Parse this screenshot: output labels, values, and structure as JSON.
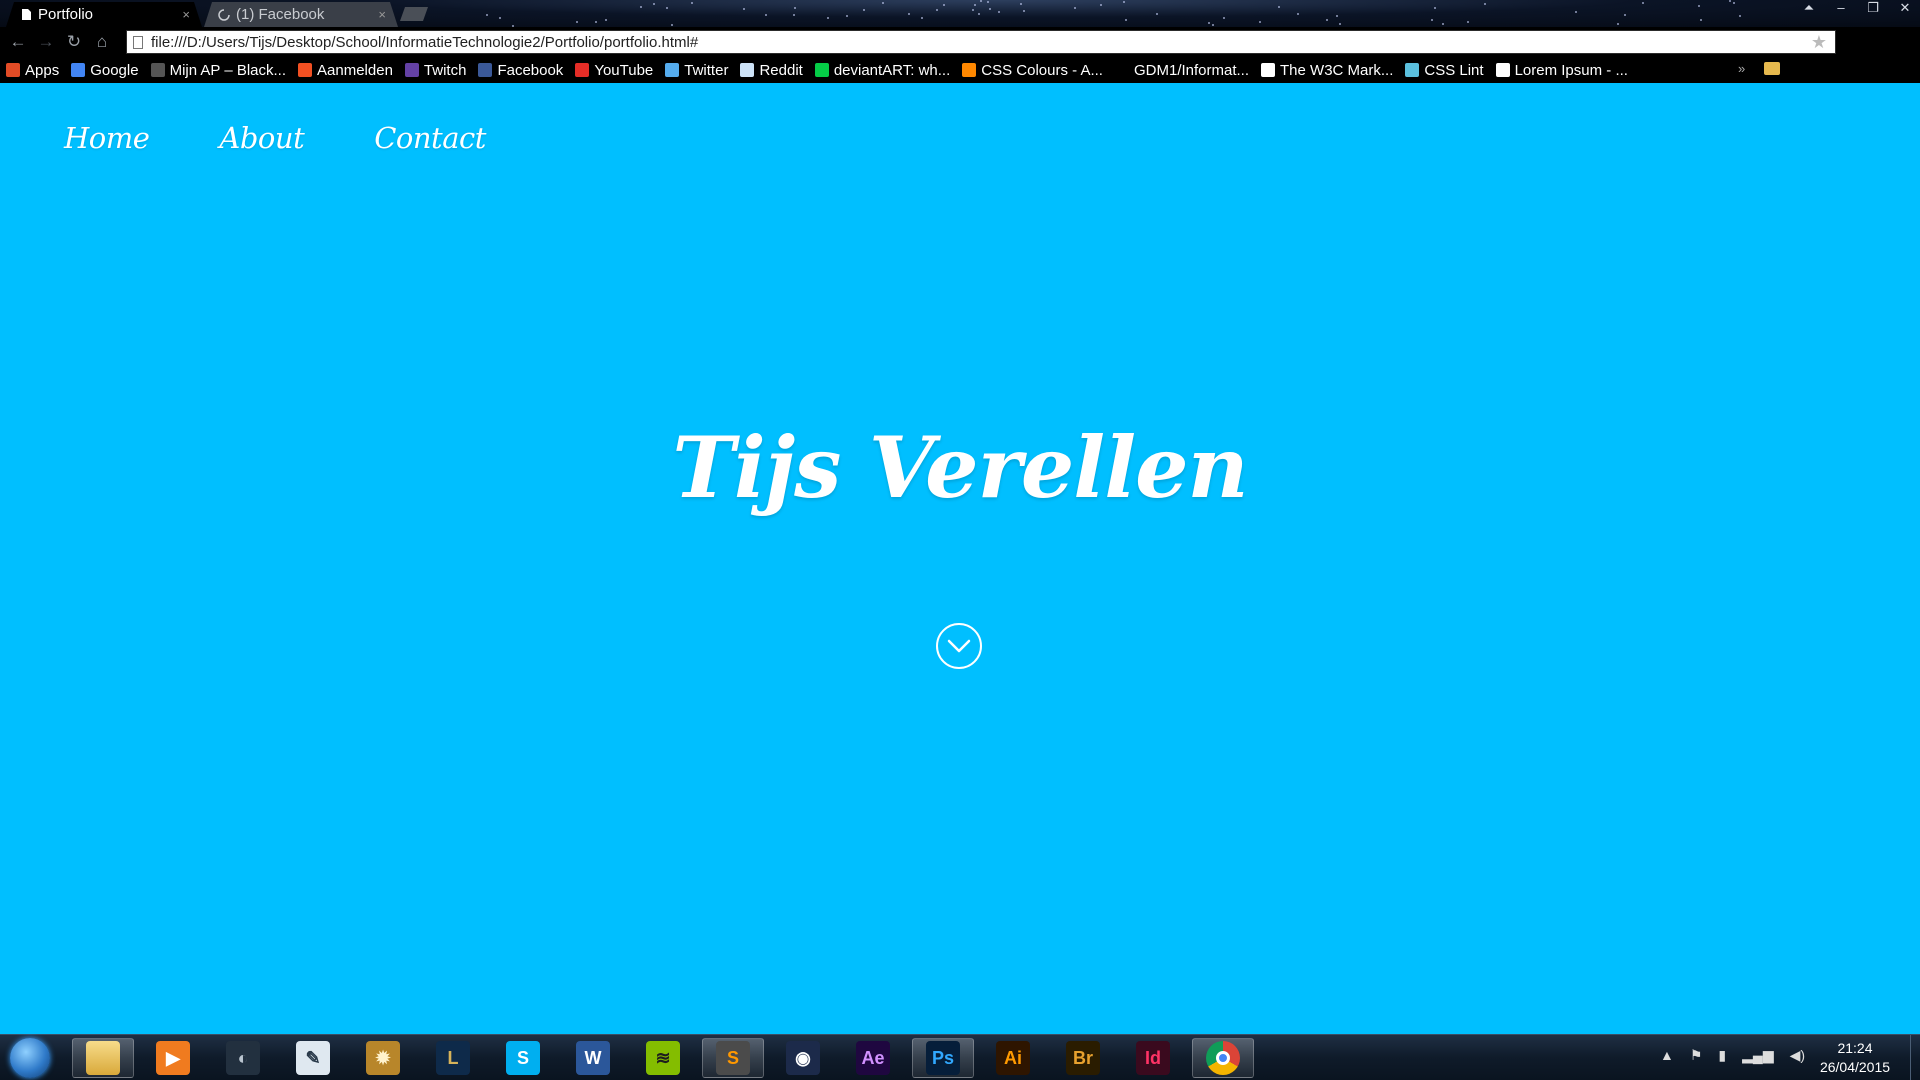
{
  "browser": {
    "tabs": [
      {
        "label": "Portfolio",
        "icon": "page-icon",
        "active": true
      },
      {
        "label": "(1) Facebook",
        "icon": "loading-spinner-icon",
        "active": false
      }
    ],
    "url": "file:///D:/Users/Tijs/Desktop/School/InformatieTechnologie2/Portfolio/portfolio.html#",
    "bookmarks": [
      {
        "label": "Apps",
        "icon": "apps-grid-icon",
        "color": "#e34c26"
      },
      {
        "label": "Google",
        "icon": "google-icon",
        "color": "#4285f4"
      },
      {
        "label": "Mijn AP – Black...",
        "icon": "blackboard-icon",
        "color": "#555555"
      },
      {
        "label": "Aanmelden",
        "icon": "microsoft-icon",
        "color": "#f25022"
      },
      {
        "label": "Twitch",
        "icon": "twitch-icon",
        "color": "#6441a5"
      },
      {
        "label": "Facebook",
        "icon": "facebook-icon",
        "color": "#3b5998"
      },
      {
        "label": "YouTube",
        "icon": "youtube-icon",
        "color": "#e52d27"
      },
      {
        "label": "Twitter",
        "icon": "twitter-icon",
        "color": "#55acee"
      },
      {
        "label": "Reddit",
        "icon": "reddit-icon",
        "color": "#cee3f8"
      },
      {
        "label": "deviantART: wh...",
        "icon": "deviantart-icon",
        "color": "#05cc47"
      },
      {
        "label": "CSS Colours - A...",
        "icon": "color-wheel-icon",
        "color": "#ff8800"
      },
      {
        "label": "GDM1/Informat...",
        "icon": "blank-page-icon",
        "color": "#000000"
      },
      {
        "label": "The W3C Mark...",
        "icon": "w3c-icon",
        "color": "#ffffff"
      },
      {
        "label": "CSS Lint",
        "icon": "csslint-icon",
        "color": "#5bc0de"
      },
      {
        "label": "Lorem Ipsum - ...",
        "icon": "lipsum-icon",
        "color": "#ffffff"
      }
    ]
  },
  "page": {
    "background": "#00bfff",
    "nav": [
      "Home",
      "About",
      "Contact"
    ],
    "title": "Tijs Verellen",
    "scroll_icon": "chevron-down-circle-icon"
  },
  "taskbar": {
    "apps": [
      {
        "name": "explorer",
        "icon": "folder-icon",
        "glyph": "",
        "bg": "#e8c15a",
        "fg": "#5a3d00",
        "active": true
      },
      {
        "name": "media-player",
        "icon": "media-player-icon",
        "glyph": "▶",
        "bg": "#f07b1f",
        "fg": "#ffffff",
        "active": false
      },
      {
        "name": "teamspeak",
        "icon": "teamspeak-icon",
        "glyph": "◐",
        "bg": "#22303f",
        "fg": "#b9c4cf",
        "active": false
      },
      {
        "name": "notepad",
        "icon": "pen-icon",
        "glyph": "✎",
        "bg": "#dfe8f0",
        "fg": "#2a3a4a",
        "active": false
      },
      {
        "name": "hearthstone",
        "icon": "hearthstone-icon",
        "glyph": "✹",
        "bg": "#b8862a",
        "fg": "#fff2cc",
        "active": false
      },
      {
        "name": "league-of-legends",
        "icon": "league-icon",
        "glyph": "L",
        "bg": "#0e2a4a",
        "fg": "#d7b35a",
        "active": false
      },
      {
        "name": "skype",
        "icon": "skype-icon",
        "glyph": "S",
        "bg": "#00aff0",
        "fg": "#ffffff",
        "active": false
      },
      {
        "name": "word",
        "icon": "word-icon",
        "glyph": "W",
        "bg": "#2b579a",
        "fg": "#ffffff",
        "active": false
      },
      {
        "name": "spotify",
        "icon": "spotify-icon",
        "glyph": "≋",
        "bg": "#84bd00",
        "fg": "#1e1e1e",
        "active": false
      },
      {
        "name": "sublime-text",
        "icon": "sublime-icon",
        "glyph": "S",
        "bg": "#4b4b4b",
        "fg": "#ff9800",
        "active": true
      },
      {
        "name": "cinema4d",
        "icon": "cinema4d-icon",
        "glyph": "◉",
        "bg": "#1c2a4a",
        "fg": "#ffffff",
        "active": false
      },
      {
        "name": "after-effects",
        "icon": "after-effects-icon",
        "glyph": "Ae",
        "bg": "#1f0740",
        "fg": "#d291ff",
        "active": false
      },
      {
        "name": "photoshop",
        "icon": "photoshop-icon",
        "glyph": "Ps",
        "bg": "#061e3a",
        "fg": "#31a8ff",
        "active": true
      },
      {
        "name": "illustrator",
        "icon": "illustrator-icon",
        "glyph": "Ai",
        "bg": "#2e1500",
        "fg": "#ff9a00",
        "active": false
      },
      {
        "name": "bridge",
        "icon": "bridge-icon",
        "glyph": "Br",
        "bg": "#2a1c00",
        "fg": "#e8a12e",
        "active": false
      },
      {
        "name": "indesign",
        "icon": "indesign-icon",
        "glyph": "Id",
        "bg": "#3a0a1e",
        "fg": "#ff3366",
        "active": false
      },
      {
        "name": "chrome",
        "icon": "chrome-icon",
        "glyph": "",
        "bg": "#ffffff",
        "fg": "#ffffff",
        "active": true
      }
    ],
    "time": "21:24",
    "date": "26/04/2015"
  }
}
